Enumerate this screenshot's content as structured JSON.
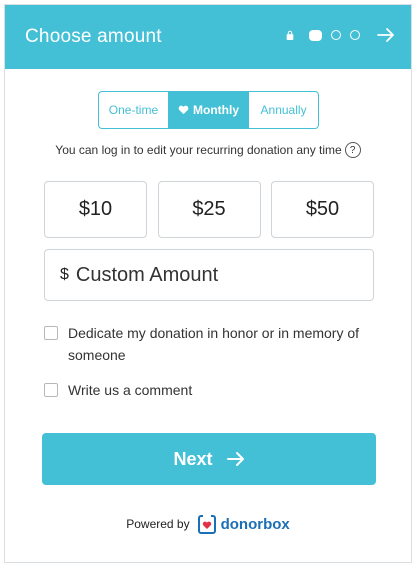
{
  "header": {
    "title": "Choose amount",
    "icons": [
      "lock-icon",
      "step-dot-active",
      "step-dot",
      "step-dot",
      "arrow-right-icon"
    ],
    "color": "#43c0d6"
  },
  "frequency": {
    "options": [
      "One-time",
      "Monthly",
      "Annually"
    ],
    "selected": "Monthly"
  },
  "note": {
    "text": "You can log in to edit your recurring donation any time",
    "help": "?"
  },
  "amounts": [
    "$10",
    "$25",
    "$50"
  ],
  "custom": {
    "currency": "$",
    "placeholder": "Custom Amount"
  },
  "options": {
    "dedicate": "Dedicate my donation in honor or in memory of someone",
    "comment": "Write us a comment"
  },
  "next_button": {
    "label": "Next"
  },
  "footer": {
    "powered_by": "Powered by",
    "brand": "donorbox",
    "brand_color": "#1b6fb5"
  }
}
